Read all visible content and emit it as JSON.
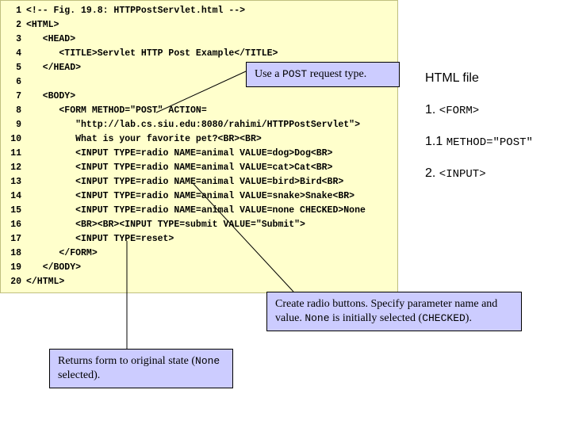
{
  "code": {
    "lines": [
      {
        "n": "1",
        "t": "<!-- Fig. 19.8: HTTPPostServlet.html -->"
      },
      {
        "n": "2",
        "t": "<HTML>"
      },
      {
        "n": "3",
        "t": "   <HEAD>"
      },
      {
        "n": "4",
        "t": "      <TITLE>Servlet HTTP Post Example</TITLE>"
      },
      {
        "n": "5",
        "t": "   </HEAD>"
      },
      {
        "n": "6",
        "t": ""
      },
      {
        "n": "7",
        "t": "   <BODY>"
      },
      {
        "n": "8",
        "t": "      <FORM METHOD=\"POST\" ACTION="
      },
      {
        "n": "9",
        "t": "         \"http://lab.cs.siu.edu:8080/rahimi/HTTPPostServlet\">"
      },
      {
        "n": "10",
        "t": "         What is your favorite pet?<BR><BR>"
      },
      {
        "n": "11",
        "t": "         <INPUT TYPE=radio NAME=animal VALUE=dog>Dog<BR>"
      },
      {
        "n": "12",
        "t": "         <INPUT TYPE=radio NAME=animal VALUE=cat>Cat<BR>"
      },
      {
        "n": "13",
        "t": "         <INPUT TYPE=radio NAME=animal VALUE=bird>Bird<BR>"
      },
      {
        "n": "14",
        "t": "         <INPUT TYPE=radio NAME=animal VALUE=snake>Snake<BR>"
      },
      {
        "n": "15",
        "t": "         <INPUT TYPE=radio NAME=animal VALUE=none CHECKED>None"
      },
      {
        "n": "16",
        "t": "         <BR><BR><INPUT TYPE=submit VALUE=\"Submit\">"
      },
      {
        "n": "17",
        "t": "         <INPUT TYPE=reset>"
      },
      {
        "n": "18",
        "t": "      </FORM>"
      },
      {
        "n": "19",
        "t": "   </BODY>"
      },
      {
        "n": "20",
        "t": "</HTML>"
      }
    ]
  },
  "callouts": {
    "post": {
      "text_a": "Use a ",
      "mono": "POST",
      "text_b": " request type."
    },
    "radio": {
      "text_a": "Create radio buttons. Specify parameter name and value. ",
      "mono1": "None",
      "text_b": " is initially selected (",
      "mono2": "CHECKED",
      "text_c": ")."
    },
    "reset": {
      "text_a": "Returns form to original state (",
      "mono": "None",
      "text_b": " selected)."
    }
  },
  "annotations": {
    "file": "HTML file",
    "form_a": "1. ",
    "form_b": "<FORM>",
    "method_a": "1.1 ",
    "method_b": "METHOD=\"POST\"",
    "input_a": "2. ",
    "input_b": "<INPUT>"
  }
}
